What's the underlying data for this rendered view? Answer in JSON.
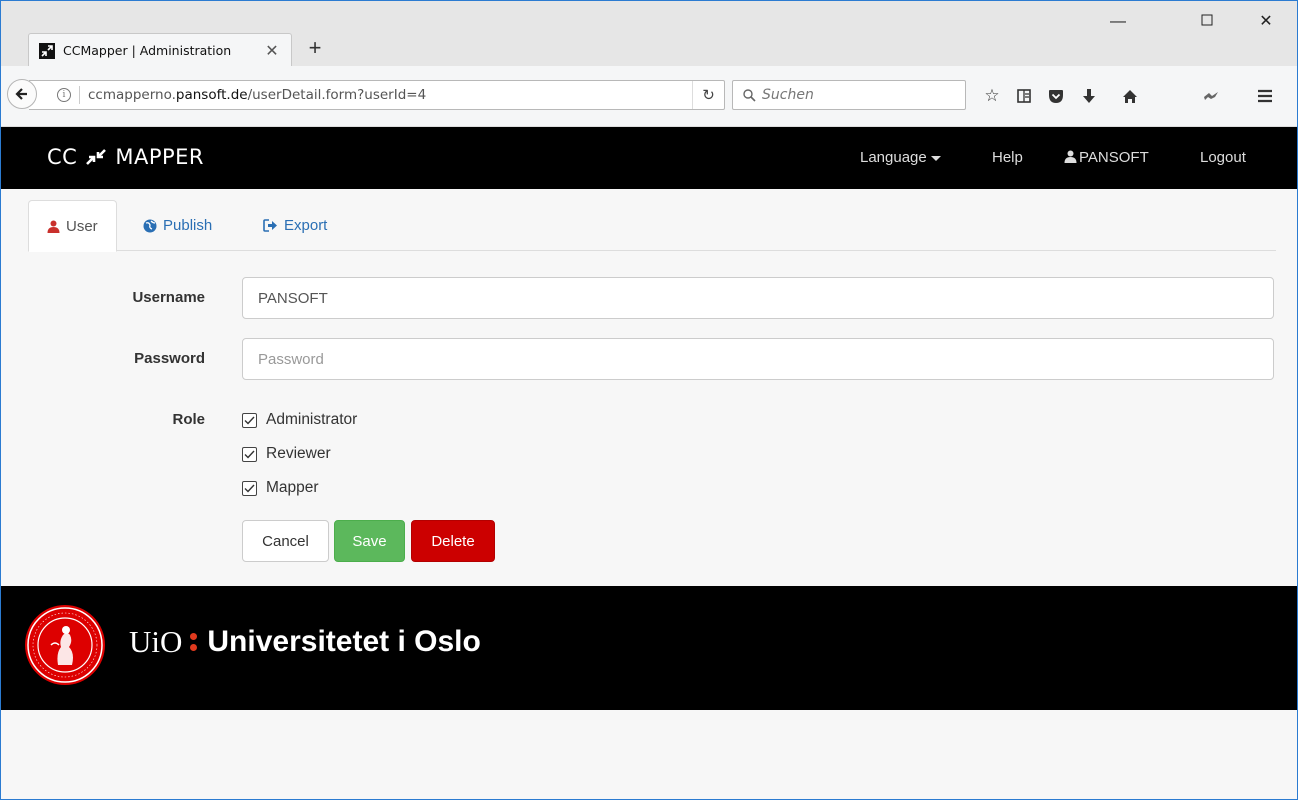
{
  "browser": {
    "tab_title": "CCMapper | Administration",
    "url_host_prefix": "ccmapperno.",
    "url_host_domain": "pansoft.de",
    "url_path": "/userDetail.form?userId=4",
    "search_placeholder": "Suchen"
  },
  "app": {
    "brand_left": "CC",
    "brand_right": "MAPPER",
    "nav": {
      "language": "Language",
      "help": "Help",
      "user": "PANSOFT",
      "logout": "Logout"
    },
    "tabs": [
      {
        "label": "User",
        "icon": "user-icon",
        "active": true
      },
      {
        "label": "Publish",
        "icon": "globe-icon",
        "active": false
      },
      {
        "label": "Export",
        "icon": "export-icon",
        "active": false
      }
    ]
  },
  "form": {
    "username_label": "Username",
    "username_value": "PANSOFT",
    "password_label": "Password",
    "password_placeholder": "Password",
    "role_label": "Role",
    "roles": [
      {
        "label": "Administrator",
        "checked": true
      },
      {
        "label": "Reviewer",
        "checked": true
      },
      {
        "label": "Mapper",
        "checked": true
      }
    ],
    "buttons": {
      "cancel": "Cancel",
      "save": "Save",
      "delete": "Delete"
    }
  },
  "footer": {
    "short": "UiO",
    "name": "Universitetet i Oslo"
  },
  "colors": {
    "header_bg": "#000000",
    "link": "#2a6fb4",
    "success": "#5cb85c",
    "danger": "#cc0000",
    "uio_red": "#dd0000"
  }
}
